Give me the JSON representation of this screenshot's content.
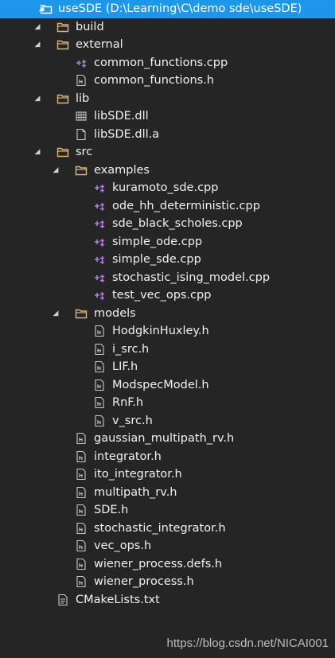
{
  "solution": {
    "project_label": "useSDE (D:\\Learning\\C\\demo sde\\useSDE)"
  },
  "tree": [
    {
      "depth": 0,
      "type": "project",
      "expanded": true,
      "label": "useSDE (D:\\Learning\\C\\demo sde\\useSDE)",
      "selected": true,
      "icon": "project-icon"
    },
    {
      "depth": 1,
      "type": "folder",
      "expanded": true,
      "label": "build",
      "icon": "folder-icon"
    },
    {
      "depth": 1,
      "type": "folder",
      "expanded": true,
      "label": "external",
      "icon": "folder-icon"
    },
    {
      "depth": 2,
      "type": "file",
      "label": "common_functions.cpp",
      "icon": "cpp-file-icon"
    },
    {
      "depth": 2,
      "type": "file",
      "label": "common_functions.h",
      "icon": "header-file-icon"
    },
    {
      "depth": 1,
      "type": "folder",
      "expanded": true,
      "label": "lib",
      "icon": "folder-icon"
    },
    {
      "depth": 2,
      "type": "file",
      "label": "libSDE.dll",
      "icon": "dll-file-icon"
    },
    {
      "depth": 2,
      "type": "file",
      "label": "libSDE.dll.a",
      "icon": "generic-file-icon"
    },
    {
      "depth": 1,
      "type": "folder",
      "expanded": true,
      "label": "src",
      "icon": "folder-icon"
    },
    {
      "depth": 2,
      "type": "folder",
      "expanded": true,
      "label": "examples",
      "icon": "folder-icon"
    },
    {
      "depth": 3,
      "type": "file",
      "label": "kuramoto_sde.cpp",
      "icon": "cpp-file-icon"
    },
    {
      "depth": 3,
      "type": "file",
      "label": "ode_hh_deterministic.cpp",
      "icon": "cpp-file-icon"
    },
    {
      "depth": 3,
      "type": "file",
      "label": "sde_black_scholes.cpp",
      "icon": "cpp-file-icon"
    },
    {
      "depth": 3,
      "type": "file",
      "label": "simple_ode.cpp",
      "icon": "cpp-file-icon"
    },
    {
      "depth": 3,
      "type": "file",
      "label": "simple_sde.cpp",
      "icon": "cpp-file-icon"
    },
    {
      "depth": 3,
      "type": "file",
      "label": "stochastic_ising_model.cpp",
      "icon": "cpp-file-icon"
    },
    {
      "depth": 3,
      "type": "file",
      "label": "test_vec_ops.cpp",
      "icon": "cpp-file-icon"
    },
    {
      "depth": 2,
      "type": "folder",
      "expanded": true,
      "label": "models",
      "icon": "folder-icon"
    },
    {
      "depth": 3,
      "type": "file",
      "label": "HodgkinHuxley.h",
      "icon": "header-file-icon"
    },
    {
      "depth": 3,
      "type": "file",
      "label": "i_src.h",
      "icon": "header-file-icon"
    },
    {
      "depth": 3,
      "type": "file",
      "label": "LIF.h",
      "icon": "header-file-icon"
    },
    {
      "depth": 3,
      "type": "file",
      "label": "ModspecModel.h",
      "icon": "header-file-icon"
    },
    {
      "depth": 3,
      "type": "file",
      "label": "RnF.h",
      "icon": "header-file-icon"
    },
    {
      "depth": 3,
      "type": "file",
      "label": "v_src.h",
      "icon": "header-file-icon"
    },
    {
      "depth": 2,
      "type": "file",
      "label": "gaussian_multipath_rv.h",
      "icon": "header-file-icon"
    },
    {
      "depth": 2,
      "type": "file",
      "label": "integrator.h",
      "icon": "header-file-icon"
    },
    {
      "depth": 2,
      "type": "file",
      "label": "ito_integrator.h",
      "icon": "header-file-icon"
    },
    {
      "depth": 2,
      "type": "file",
      "label": "multipath_rv.h",
      "icon": "header-file-icon"
    },
    {
      "depth": 2,
      "type": "file",
      "label": "SDE.h",
      "icon": "header-file-icon"
    },
    {
      "depth": 2,
      "type": "file",
      "label": "stochastic_integrator.h",
      "icon": "header-file-icon"
    },
    {
      "depth": 2,
      "type": "file",
      "label": "vec_ops.h",
      "icon": "header-file-icon"
    },
    {
      "depth": 2,
      "type": "file",
      "label": "wiener_process.defs.h",
      "icon": "header-file-icon"
    },
    {
      "depth": 2,
      "type": "file",
      "label": "wiener_process.h",
      "icon": "header-file-icon"
    },
    {
      "depth": 1,
      "type": "file",
      "label": "CMakeLists.txt",
      "icon": "text-file-icon"
    }
  ],
  "watermark": "https://blog.csdn.net/NICAI001",
  "colors": {
    "background": "#252526",
    "selection": "#1c97ea",
    "folder": "#dcb67a",
    "cpp_accent": "#b180d7",
    "text": "#f1f1f1"
  }
}
